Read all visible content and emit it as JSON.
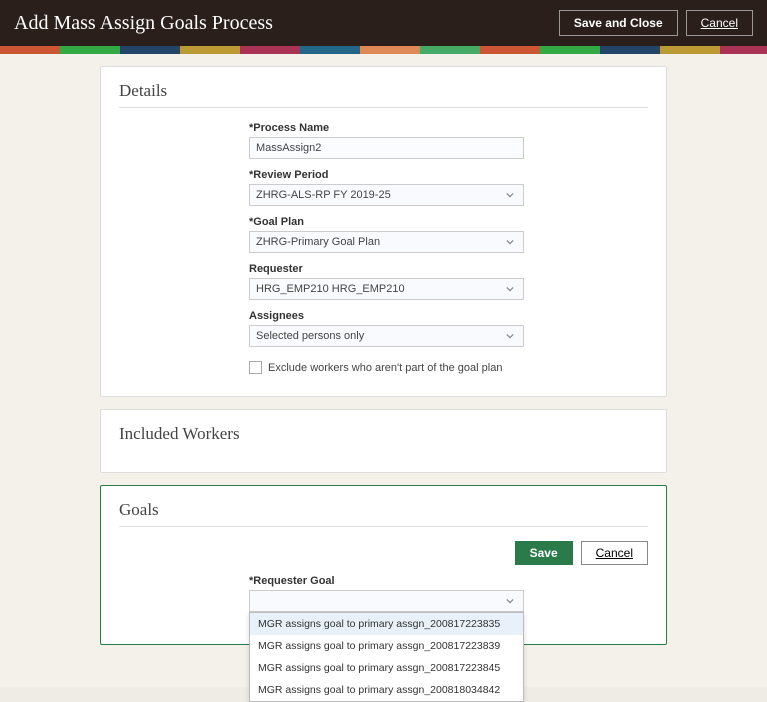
{
  "header": {
    "title": "Add Mass Assign Goals Process",
    "save_close": "Save and Close",
    "cancel": "Cancel"
  },
  "details": {
    "heading": "Details",
    "process_name_label": "Process Name",
    "process_name_value": "MassAssign2",
    "review_period_label": "Review Period",
    "review_period_value": "ZHRG-ALS-RP FY 2019-25",
    "goal_plan_label": "Goal Plan",
    "goal_plan_value": "ZHRG-Primary Goal Plan",
    "requester_label": "Requester",
    "requester_value": "HRG_EMP210 HRG_EMP210",
    "assignees_label": "Assignees",
    "assignees_value": "Selected persons only",
    "exclude_label": "Exclude workers who aren't part of the goal plan"
  },
  "workers": {
    "heading": "Included Workers"
  },
  "goals": {
    "heading": "Goals",
    "save": "Save",
    "cancel": "Cancel",
    "requester_goal_label": "Requester Goal",
    "requester_goal_value": "",
    "options": [
      "MGR assigns goal to primary assgn_200817223835",
      "MGR assigns goal to primary assgn_200817223839",
      "MGR assigns goal to primary assgn_200817223845",
      "MGR assigns goal to primary assgn_200818034842"
    ]
  }
}
